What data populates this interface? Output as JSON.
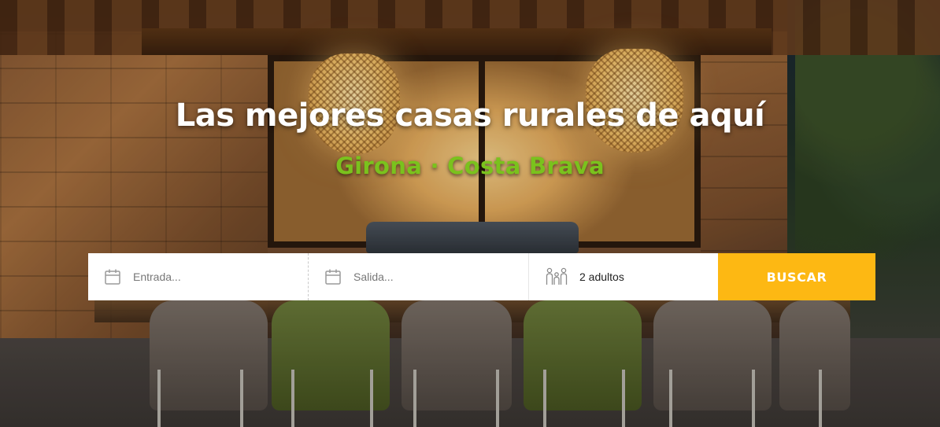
{
  "hero": {
    "title": "Las mejores casas rurales de aquí",
    "subtitle": "Girona · Costa Brava"
  },
  "search": {
    "checkin_placeholder": "Entrada...",
    "checkin_value": "",
    "checkout_placeholder": "Salida...",
    "checkout_value": "",
    "guests_value": "2 adultos",
    "button_label": "BUSCAR"
  },
  "icons": {
    "checkin": "calendar-icon",
    "checkout": "calendar-icon",
    "guests": "family-icon"
  },
  "colors": {
    "title": "#ffffff",
    "subtitle": "#7ac21d",
    "button_bg": "#fdb813",
    "button_text": "#ffffff",
    "icon": "#9a9a9a"
  }
}
